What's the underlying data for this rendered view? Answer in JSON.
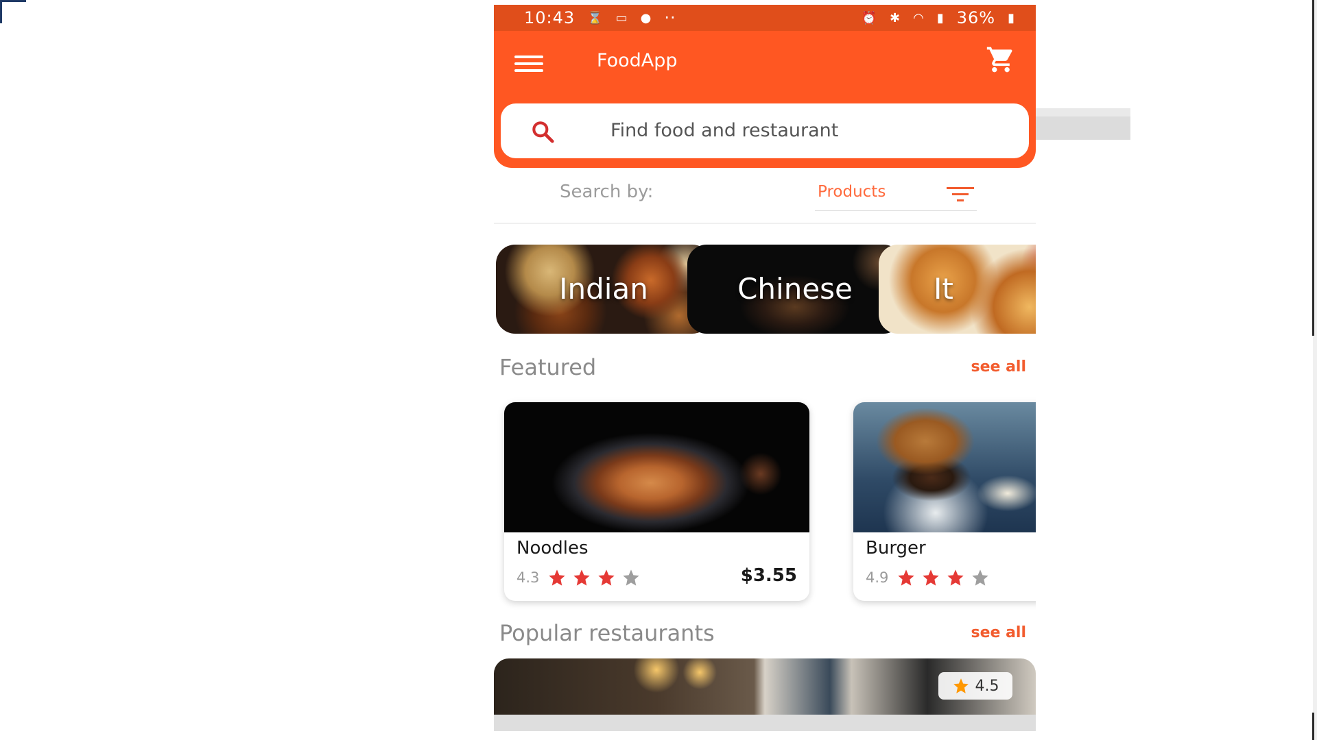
{
  "status_bar": {
    "time": "10:43",
    "extra_dots": "··",
    "battery": "36%"
  },
  "app_bar": {
    "title": "FoodApp"
  },
  "search": {
    "placeholder": "Find food and restaurant"
  },
  "search_by": {
    "label": "Search by:",
    "value": "Products"
  },
  "categories": [
    {
      "label": "Indian"
    },
    {
      "label": "Chinese"
    },
    {
      "label": "It"
    }
  ],
  "featured": {
    "title": "Featured",
    "see_all": "see all",
    "items": [
      {
        "name": "Noodles",
        "rating": "4.3",
        "stars_filled": 3,
        "stars_total": 4,
        "price": "$3.55"
      },
      {
        "name": "Burger",
        "rating": "4.9",
        "stars_filled": 3,
        "stars_total": 4,
        "price": ""
      }
    ]
  },
  "popular": {
    "title": "Popular restaurants",
    "see_all": "see all",
    "first_rating": "4.5"
  },
  "colors": {
    "primary": "#ff5722",
    "status": "#e04e1b",
    "accent": "#f25c2e",
    "star": "#e53935"
  }
}
